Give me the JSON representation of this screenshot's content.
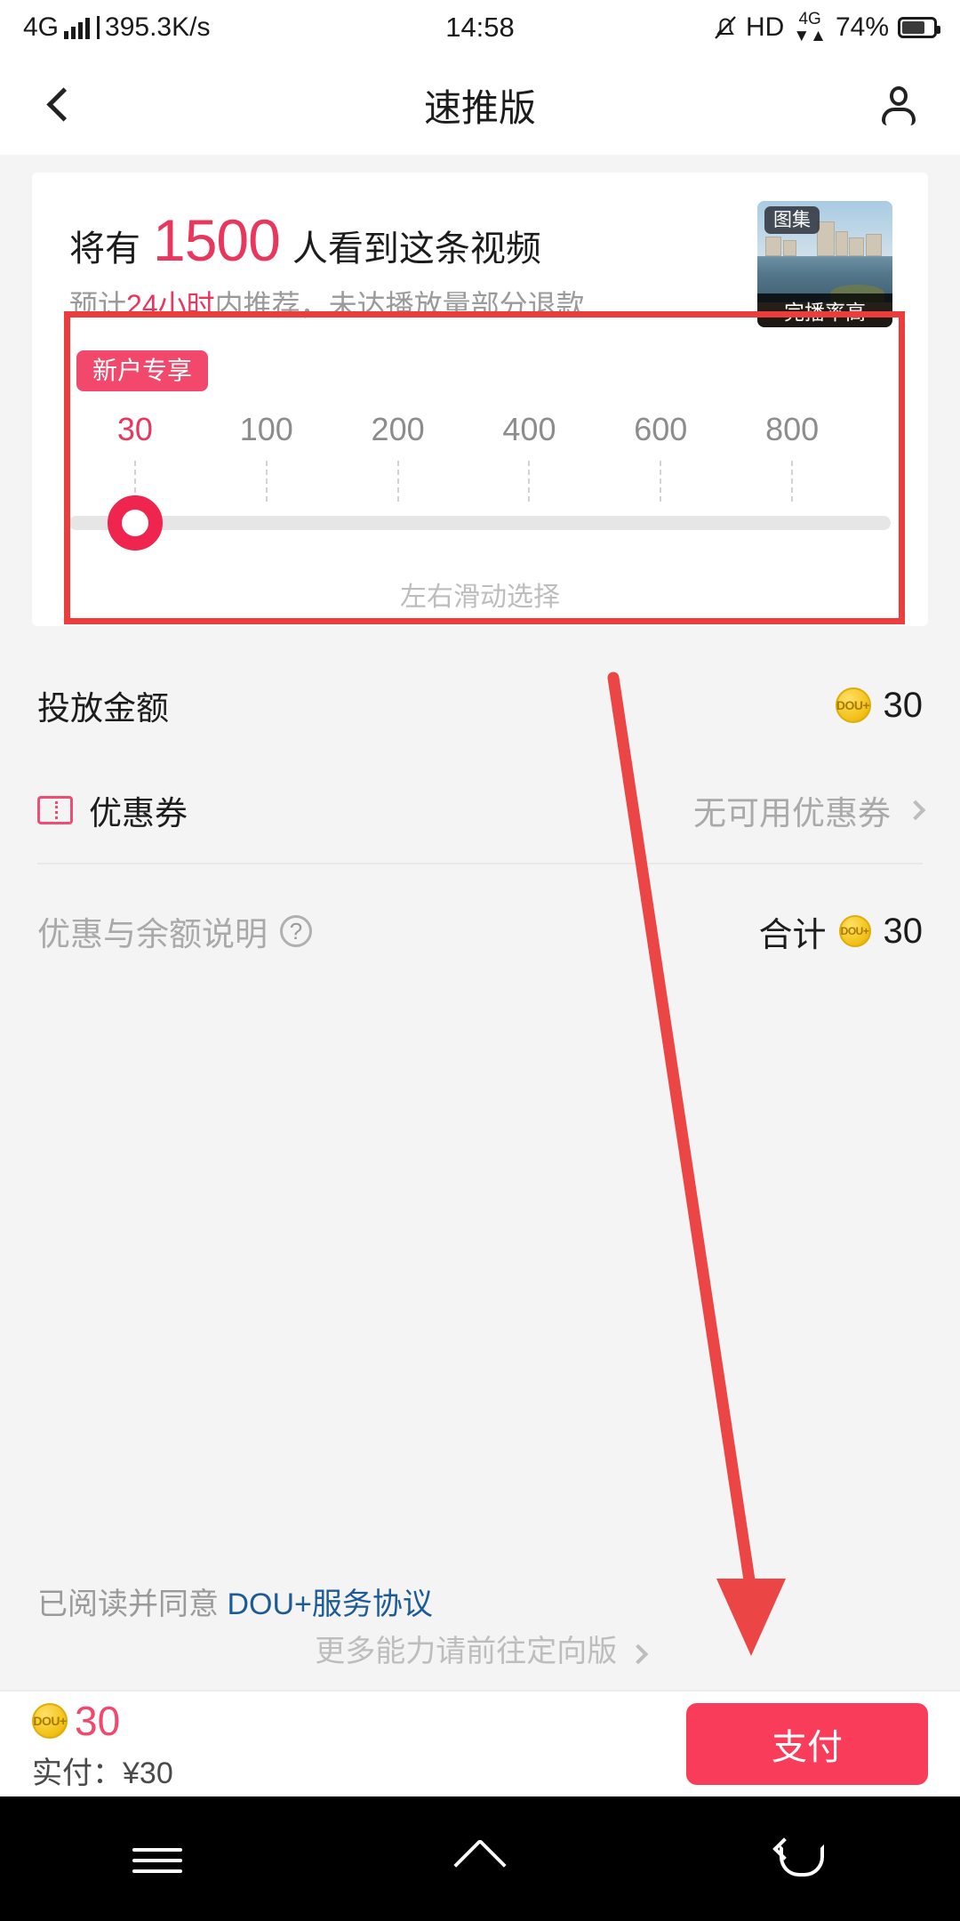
{
  "status_bar": {
    "network_type": "4G",
    "speed": "395.3K/s",
    "time": "14:58",
    "hd_label": "HD",
    "secondary_network": "4G",
    "battery_percent": "74%",
    "mute_icon": "bell-muted-icon"
  },
  "header": {
    "title": "速推版",
    "back_icon": "back-chevron-icon",
    "account_icon": "person-icon"
  },
  "promo": {
    "headline_prefix": "将有",
    "headline_count": "1500",
    "headline_suffix": "人看到这条视频",
    "sub_prefix": "预计",
    "sub_highlight": "24小时",
    "sub_suffix": "内推荐，未达播放量部分退款",
    "thumbnail_badge": "图集",
    "thumbnail_footer": "完播率高",
    "new_user_badge": "新户专享",
    "slide_hint": "左右滑动选择"
  },
  "slider": {
    "ticks": [
      "30",
      "100",
      "200",
      "400",
      "600",
      "800"
    ],
    "selected_value": "30",
    "selected_index": 0,
    "active_color": "#e8365d",
    "track_color": "#e6e6e6"
  },
  "rows": {
    "amount_label": "投放金额",
    "amount_value": "30",
    "coupon_label": "优惠券",
    "coupon_value": "无可用优惠券",
    "explain_label": "优惠与余额说明",
    "total_label": "合计",
    "total_value": "30",
    "agreement_prefix": "已阅读并同意",
    "agreement_link": "DOU+服务协议",
    "coin_icon_text": "DOU+"
  },
  "footer_link": {
    "label": "更多能力请前往定向版"
  },
  "bottom_bar": {
    "coin_amount": "30",
    "actual_pay": "实付：¥30",
    "pay_button": "支付",
    "pay_button_color": "#fa3c5b"
  },
  "android_nav": {
    "menu_icon": "menu-icon",
    "home_icon": "home-icon",
    "back_icon": "back-icon"
  },
  "annotations": {
    "highlight_box_color": "#ec3c3c",
    "arrow_color": "#ec4545"
  }
}
